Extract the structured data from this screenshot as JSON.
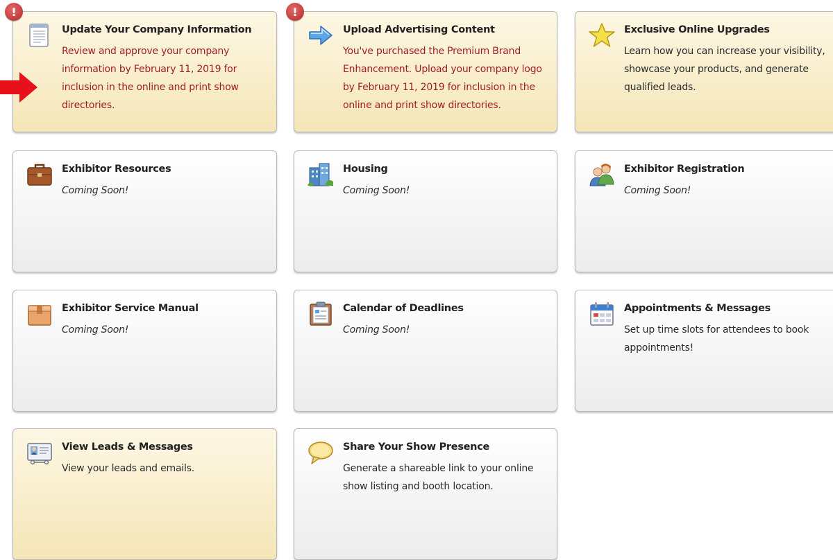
{
  "tiles": [
    {
      "title": "Update Your Company Information",
      "desc": "Review and approve your company information by February 11, 2019 for inclusion in the online and print show directories.",
      "icon": "document-icon"
    },
    {
      "title": "Upload Advertising Content",
      "desc": "You've purchased the Premium Brand Enhancement. Upload your company logo by February 11, 2019 for inclusion in the online and print show directories.",
      "icon": "upload-arrow-icon"
    },
    {
      "title": "Exclusive Online Upgrades",
      "desc": "Learn how you can increase your visibility, showcase your products, and generate qualified leads.",
      "icon": "star-icon"
    },
    {
      "title": "Exhibitor Resources",
      "desc": "Coming Soon!",
      "icon": "briefcase-icon"
    },
    {
      "title": "Housing",
      "desc": "Coming Soon!",
      "icon": "building-icon"
    },
    {
      "title": "Exhibitor Registration",
      "desc": "Coming Soon!",
      "icon": "users-icon"
    },
    {
      "title": "Exhibitor Service Manual",
      "desc": "Coming Soon!",
      "icon": "box-icon"
    },
    {
      "title": "Calendar of Deadlines",
      "desc": "Coming Soon!",
      "icon": "clipboard-icon"
    },
    {
      "title": "Appointments & Messages",
      "desc": "Set up time slots for attendees to book appointments!",
      "icon": "calendar-icon"
    },
    {
      "title": "View Leads & Messages",
      "desc": "View your leads and emails.",
      "icon": "id-card-icon"
    },
    {
      "title": "Share Your Show Presence",
      "desc": "Generate a shareable link to your online show listing and booth location.",
      "icon": "speech-bubble-icon"
    }
  ],
  "alert_badge": "!",
  "colors": {
    "alert_text": "#a11d24",
    "pointer_arrow": "#e8101a",
    "tile_highlight": "#f5e6b7"
  }
}
